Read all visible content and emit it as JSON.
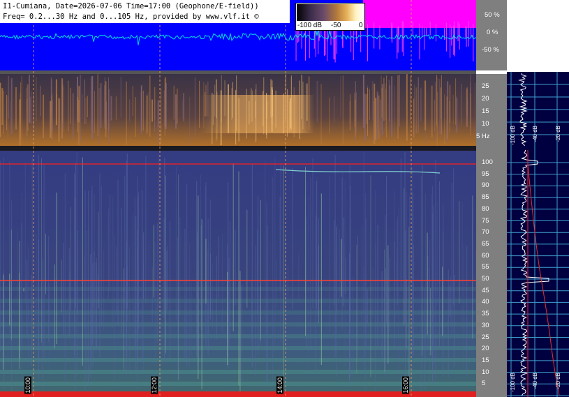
{
  "header": {
    "line1": "I1-Cumiana, Date=2026-07-06 Time=17:00 (Geophone/E-field))",
    "line2": "Freq= 0.2...30 Hz and 0...105 Hz, provided by www.vlf.it ©"
  },
  "colorbar": {
    "min_label": "-100 dB",
    "mid_label": "-50",
    "max_label": "0"
  },
  "amplitude_axis": {
    "labels": [
      "50 %",
      "0 %",
      "-50 %"
    ]
  },
  "low_freq_axis": {
    "labels": [
      "25",
      "20",
      "15",
      "10",
      "5 Hz"
    ]
  },
  "high_freq_axis": {
    "labels": [
      "100",
      "95",
      "90",
      "85",
      "80",
      "75",
      "70",
      "65",
      "60",
      "55",
      "50",
      "45",
      "40",
      "35",
      "30",
      "25",
      "20",
      "15",
      "10",
      "5"
    ]
  },
  "time_markers": [
    "10:00",
    "12:00",
    "14:00",
    "16:00"
  ],
  "side_panel_top_labels": [
    "-100 dB",
    "-40 dB",
    "-20 dB"
  ],
  "side_panel_bottom_labels": [
    "-100 dB",
    "-40 dB",
    "-20 dB"
  ],
  "colors": {
    "amplitude_bg": "#0000ff",
    "trace": "#00e0e0",
    "magenta_band": "#ff00ff",
    "spectrogram_bg": "#333a7a",
    "side_panel_bg": "#000040",
    "grid": "#3fa0d0",
    "red_line": "#ff2020"
  }
}
